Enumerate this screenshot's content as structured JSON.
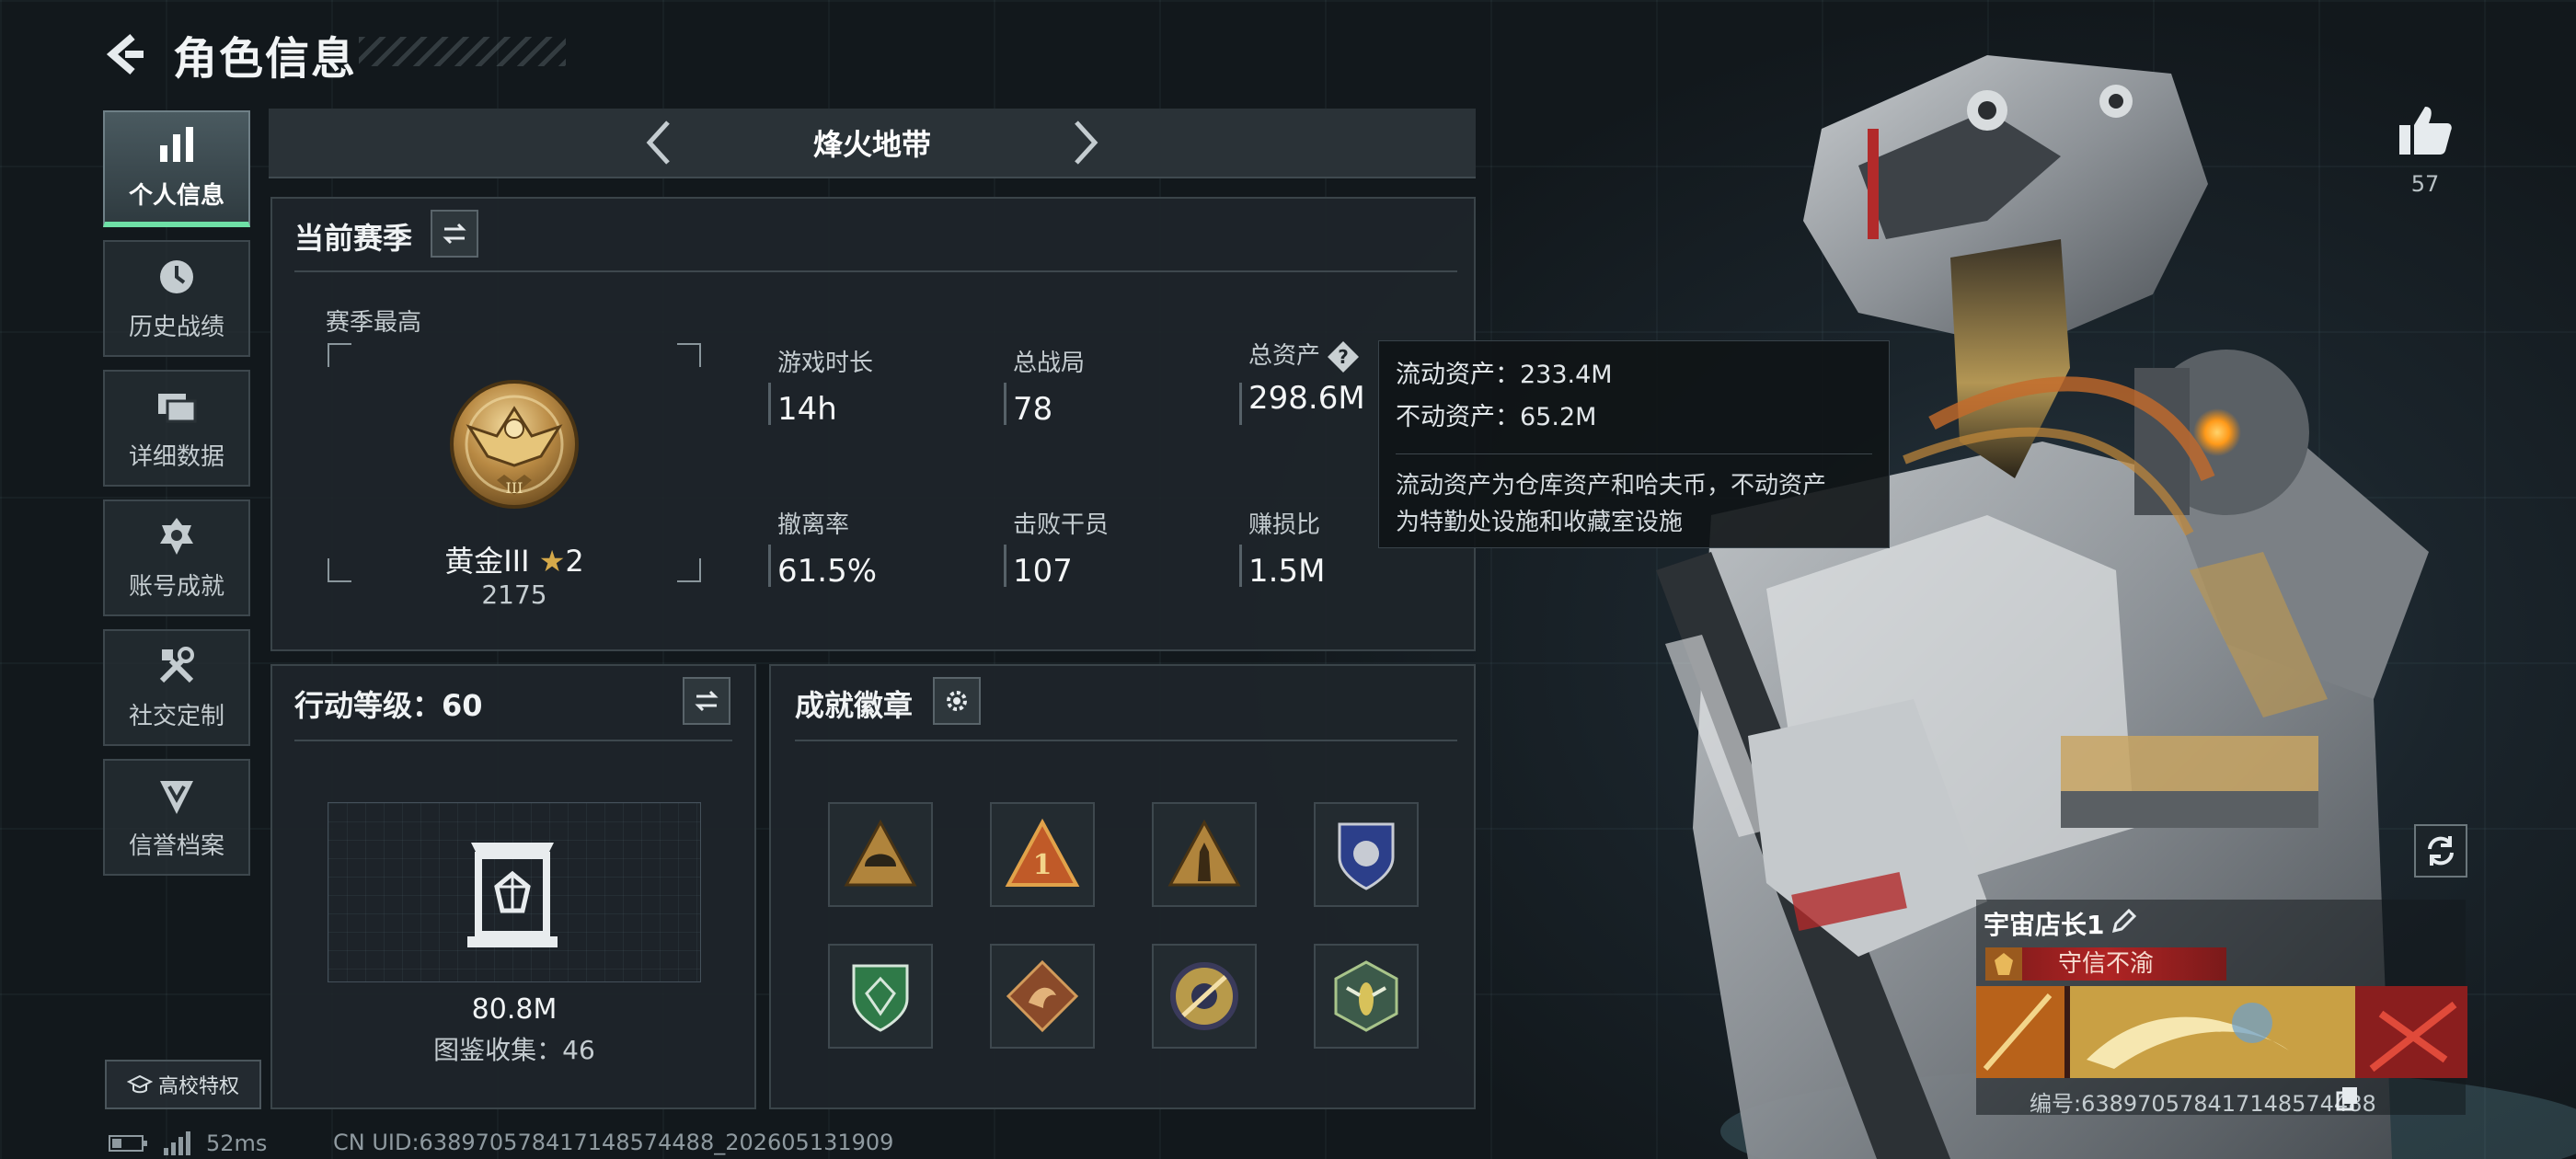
{
  "header": {
    "title": "角色信息"
  },
  "nav": {
    "items": [
      {
        "label": "个人信息",
        "icon": "bar-chart-icon"
      },
      {
        "label": "历史战绩",
        "icon": "history-icon"
      },
      {
        "label": "详细数据",
        "icon": "stack-icon"
      },
      {
        "label": "账号成就",
        "icon": "achievement-icon"
      },
      {
        "label": "社交定制",
        "icon": "tools-icon"
      },
      {
        "label": "信誉档案",
        "icon": "credit-icon"
      }
    ],
    "active_index": 0
  },
  "school_button": {
    "label": "高校特权"
  },
  "mode": {
    "title": "烽火地带"
  },
  "season": {
    "title": "当前赛季",
    "best_label": "赛季最高",
    "rank_name": "黄金III",
    "rank_stars": "2",
    "rank_score": "2175",
    "stats": [
      {
        "label": "游戏时长",
        "value": "14h"
      },
      {
        "label": "总战局",
        "value": "78"
      },
      {
        "label": "总资产",
        "value": "298.6M"
      },
      {
        "label": "撤离率",
        "value": "61.5%"
      },
      {
        "label": "击败干员",
        "value": "107"
      },
      {
        "label": "赚损比",
        "value": "1.5M"
      }
    ]
  },
  "tooltip": {
    "liquid": "流动资产：233.4M",
    "fixed": "不动资产：65.2M",
    "note_line1": "流动资产为仓库资产和哈夫币，不动资产",
    "note_line2": "为特勤处设施和收藏室设施"
  },
  "level": {
    "title": "行动等级：60",
    "value": "80.8M",
    "collection": "图鉴收集：46"
  },
  "badges": {
    "title": "成就徽章",
    "items": [
      "badge-helmet-icon",
      "badge-number-one-icon",
      "badge-soldier-icon",
      "badge-blue-shield-icon",
      "badge-green-shield-icon",
      "badge-dragon-icon",
      "badge-gold-emblem-icon",
      "badge-wasp-icon"
    ]
  },
  "likes": {
    "count": "57"
  },
  "player": {
    "name": "宇宙店长1",
    "title": "守信不渝",
    "id": "编号:638970578417148574488"
  },
  "footer": {
    "ping": "52ms",
    "uid": "CN UID:638970578417148574488_202605131909"
  },
  "colors": {
    "accent": "#6ee0a6",
    "tag_red": "#b02424",
    "gold": "#d5a94a"
  }
}
